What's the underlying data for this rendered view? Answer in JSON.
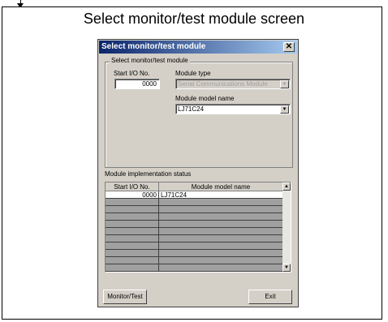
{
  "caption": "Select monitor/test module screen",
  "dialog": {
    "title": "Select monitor/test module",
    "close_glyph": "✕",
    "group_label": "Select monitor/test module",
    "start_io_label": "Start I/O No.",
    "start_io_value": "0000",
    "module_type_label": "Module type",
    "module_type_value": "Serial Communications Module",
    "module_model_label": "Module model name",
    "module_model_value": "LJ71C24",
    "impl_status_label": "Module implementation status",
    "table": {
      "headers": [
        "Start I/O No.",
        "Module model name"
      ],
      "rows": [
        {
          "start_io": "0000",
          "model": "LJ71C24"
        }
      ]
    },
    "monitor_button": "Monitor/Test",
    "exit_button": "Exit"
  }
}
